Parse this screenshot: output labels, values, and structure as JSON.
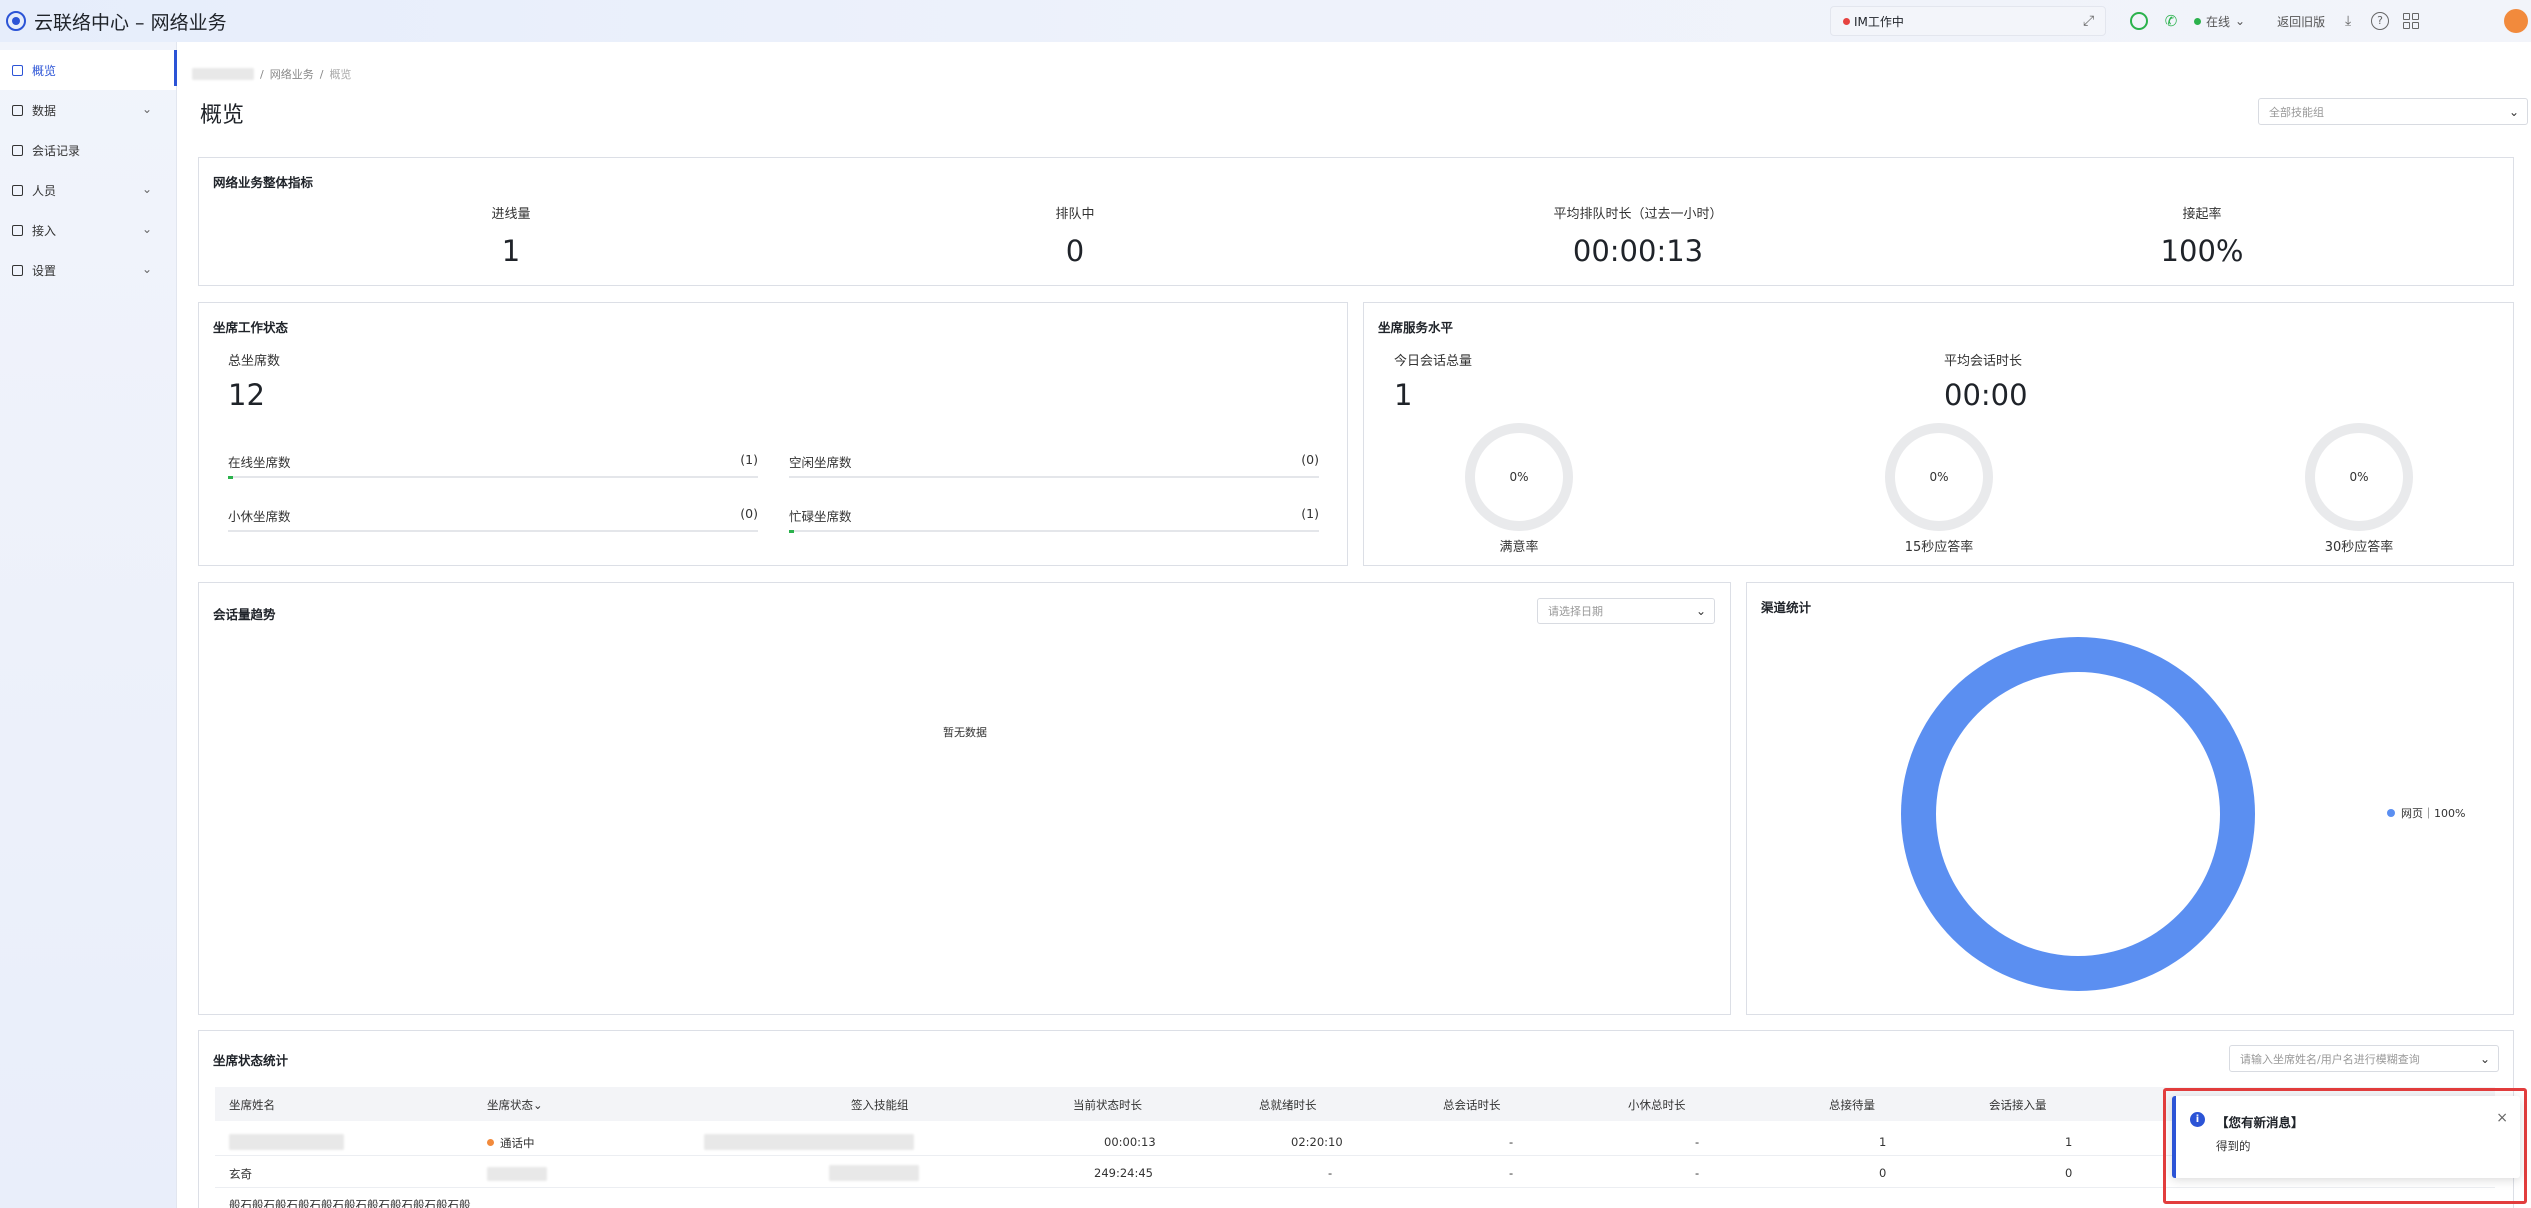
{
  "header": {
    "app_title": "云联络中心 – 网络业务",
    "im_status_label": "IM工作中",
    "online_status": "在线",
    "return_old_link": "返回旧版"
  },
  "sidebar": {
    "items": [
      {
        "label": "概览",
        "icon": "dashboard-icon",
        "active": true
      },
      {
        "label": "数据",
        "icon": "data-icon",
        "expandable": true
      },
      {
        "label": "会话记录",
        "icon": "records-icon"
      },
      {
        "label": "人员",
        "icon": "people-icon",
        "expandable": true
      },
      {
        "label": "接入",
        "icon": "access-icon",
        "expandable": true
      },
      {
        "label": "设置",
        "icon": "settings-icon",
        "expandable": true
      }
    ]
  },
  "breadcrumb": [
    "网络业务",
    "概览"
  ],
  "page_title": "概览",
  "skill_group_select": {
    "placeholder": "全部技能组"
  },
  "overall": {
    "title": "网络业务整体指标",
    "metrics": [
      {
        "label": "进线量",
        "value": "1"
      },
      {
        "label": "排队中",
        "value": "0"
      },
      {
        "label": "平均排队时长（过去一小时）",
        "value": "00:00:13"
      },
      {
        "label": "接起率",
        "value": "100%"
      }
    ]
  },
  "agent_work": {
    "title": "坐席工作状态",
    "total_label": "总坐席数",
    "total_value": "12",
    "bars": [
      {
        "label": "在线坐席数",
        "count": "(1)",
        "ratio": 0.01
      },
      {
        "label": "空闲坐席数",
        "count": "(0)",
        "ratio": 0
      },
      {
        "label": "小休坐席数",
        "count": "(0)",
        "ratio": 0
      },
      {
        "label": "忙碌坐席数",
        "count": "(1)",
        "ratio": 0.01
      }
    ]
  },
  "service_level": {
    "title": "坐席服务水平",
    "today_label": "今日会话总量",
    "today_value": "1",
    "avg_label": "平均会话时长",
    "avg_value": "00:00",
    "rings": [
      {
        "value": "0%",
        "label": "满意率"
      },
      {
        "value": "0%",
        "label": "15秒应答率"
      },
      {
        "value": "0%",
        "label": "30秒应答率"
      }
    ]
  },
  "trend": {
    "title": "会话量趋势",
    "date_placeholder": "请选择日期",
    "no_data": "暂无数据"
  },
  "channel": {
    "title": "渠道统计",
    "legend_label": "网页｜100%",
    "color": "#5b8ff1"
  },
  "agent_table": {
    "title": "坐席状态统计",
    "search_placeholder": "请输入坐席姓名/用户名进行模糊查询",
    "columns": [
      "坐席姓名",
      "坐席状态",
      "签入技能组",
      "当前状态时长",
      "总就绪时长",
      "总会话时长",
      "小休总时长",
      "总接待量",
      "会话接入量"
    ],
    "rows": [
      {
        "name": "",
        "status": "通话中",
        "status_color": "#f28a3c",
        "group": "",
        "current": "00:00:13",
        "ready": "02:20:10",
        "talk": "-",
        "break": "-",
        "total": "1",
        "in": "1"
      },
      {
        "name": "玄奇",
        "status": "",
        "status_color": "",
        "group": "",
        "current": "249:24:45",
        "ready": "-",
        "talk": "-",
        "break": "-",
        "total": "0",
        "in": "0"
      },
      {
        "name": "般石般石般石般石般石般石般石般石般石般石般",
        "status": "",
        "status_color": "",
        "group": "",
        "current": "",
        "ready": "",
        "talk": "",
        "break": "",
        "total": "",
        "in": ""
      }
    ]
  },
  "notification": {
    "title": "【您有新消息】",
    "body": "得到的"
  }
}
